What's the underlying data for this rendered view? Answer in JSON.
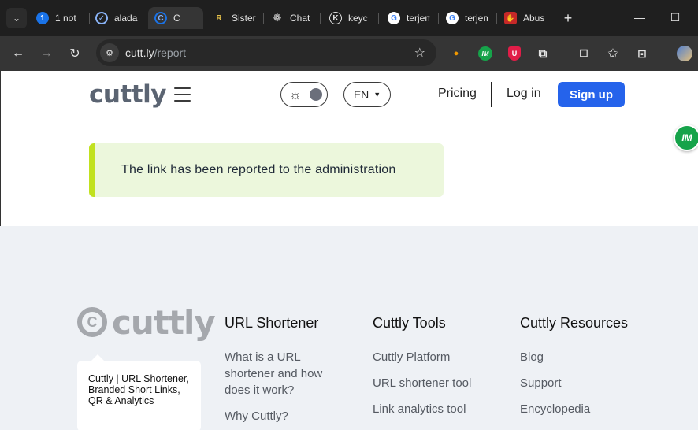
{
  "browser": {
    "tabs": [
      {
        "icon": "1",
        "icon_name": "badge-one-icon",
        "label": "1 not",
        "icon_color": "#1a73e8"
      },
      {
        "icon": "✓",
        "icon_name": "shield-check-icon",
        "label": "alada",
        "icon_color": "#8ab4f8"
      },
      {
        "icon": "C",
        "icon_name": "cuttly-favicon-icon",
        "label": "C",
        "icon_color": "#1a73e8",
        "active": true
      },
      {
        "icon": "R",
        "icon_name": "sister-favicon-icon",
        "label": "Sister",
        "icon_color": "#e8c34a"
      },
      {
        "icon": "❁",
        "icon_name": "chatgpt-icon",
        "label": "Chat",
        "icon_color": "#e3e3e3"
      },
      {
        "icon": "K",
        "icon_name": "keycdn-icon",
        "label": "keyc",
        "icon_color": "#e3e3e3"
      },
      {
        "icon": "G",
        "icon_name": "google-icon",
        "label": "terjem",
        "icon_color": "#4285f4"
      },
      {
        "icon": "G",
        "icon_name": "google-icon",
        "label": "terjem",
        "icon_color": "#4285f4"
      },
      {
        "icon": "✋",
        "icon_name": "abuse-hand-icon",
        "label": "Abus",
        "icon_color": "#c62828"
      }
    ],
    "new_tab": "+",
    "window_controls": {
      "minimize": "—",
      "maximize": "☐",
      "close": "✕"
    },
    "address": {
      "host": "cutt.ly",
      "path": "/report"
    }
  },
  "header": {
    "logo": "cuttly",
    "language": "EN",
    "nav": {
      "pricing": "Pricing",
      "login": "Log in",
      "signup": "Sign up"
    }
  },
  "extension_badge": "IM",
  "alert": {
    "message": "The link has been reported to the administration"
  },
  "footer": {
    "logo_word": "cuttly",
    "logo_mark": "C",
    "tagline": "Cuttly | URL Shortener, Branded Short Links, QR & Analytics",
    "columns": [
      {
        "title": "URL Shortener",
        "links": [
          "What is a URL shortener and how does it work?",
          "Why Cuttly?"
        ]
      },
      {
        "title": "Cuttly Tools",
        "links": [
          "Cuttly Platform",
          "URL shortener tool",
          "Link analytics tool"
        ]
      },
      {
        "title": "Cuttly Resources",
        "links": [
          "Blog",
          "Support",
          "Encyclopedia"
        ]
      }
    ]
  },
  "colors": {
    "brand_blue": "#2563eb",
    "alert_bg": "#ecf7dc",
    "alert_accent": "#c1e11f",
    "footer_bg": "#eef1f5"
  }
}
